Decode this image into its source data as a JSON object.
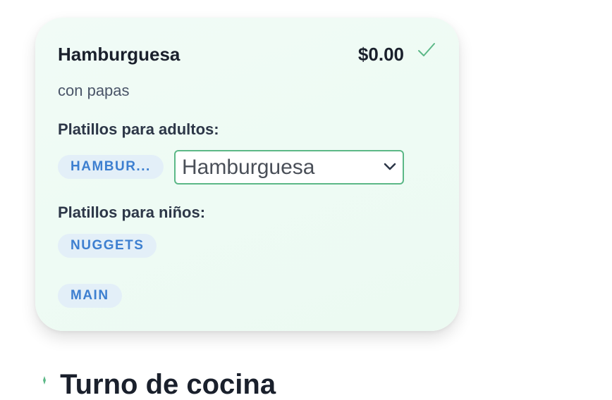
{
  "card": {
    "title": "Hamburguesa",
    "price": "$0.00",
    "status_icon": "check-icon",
    "subtitle": "con papas",
    "adults_label": "Platillos para adultos:",
    "adults_chip": "HAMBUR...",
    "adults_select": {
      "selected": "Hamburguesa",
      "icon": "chevron-down-icon"
    },
    "kids_label": "Platillos para niños:",
    "kids_chip": "NUGGETS",
    "category_chip": "MAIN"
  },
  "below": {
    "heading_partial": "Turno de cocina",
    "icon": "sparkle-icon"
  },
  "colors": {
    "card_bg": "#eefbf4",
    "accent_green": "#5cb887",
    "chip_bg": "#e3eff8",
    "chip_text": "#3d7fd0",
    "text_dark": "#1a202c"
  }
}
